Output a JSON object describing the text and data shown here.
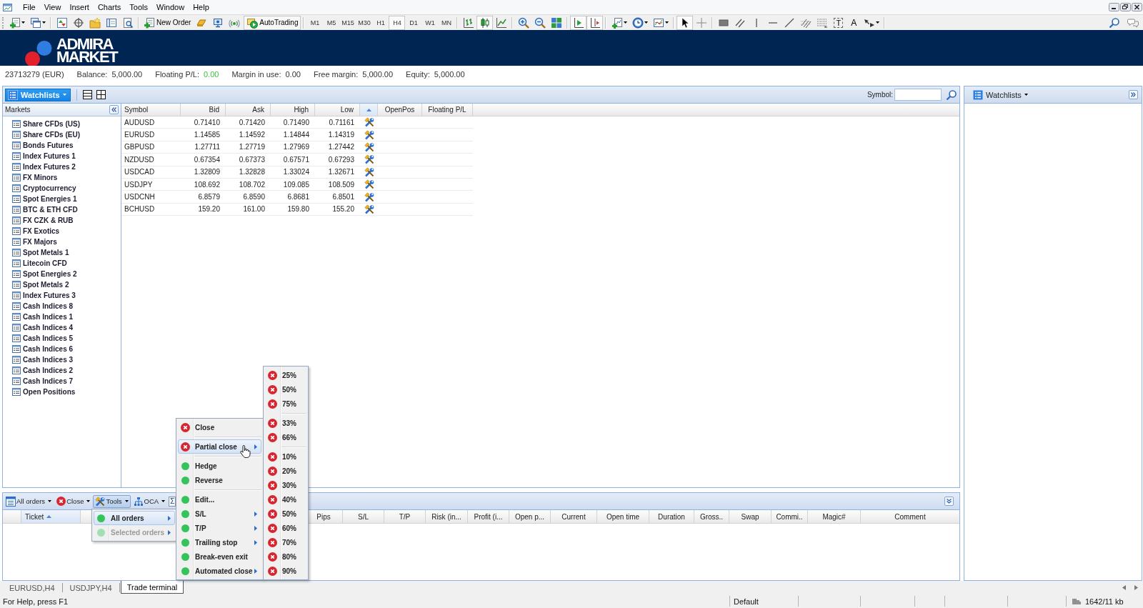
{
  "menu_bar": {
    "items": [
      "File",
      "View",
      "Insert",
      "Charts",
      "Tools",
      "Window",
      "Help"
    ]
  },
  "toolbar": {
    "new_order_label": "New Order",
    "autotrading": {
      "label": "AutoTrading",
      "on": true
    },
    "timeframes": [
      {
        "label": "M1",
        "selected": false
      },
      {
        "label": "M5",
        "selected": false
      },
      {
        "label": "M15",
        "selected": false
      },
      {
        "label": "M30",
        "selected": false
      },
      {
        "label": "H1",
        "selected": false
      },
      {
        "label": "H4",
        "selected": true
      },
      {
        "label": "D1",
        "selected": false
      },
      {
        "label": "W1",
        "selected": false
      },
      {
        "label": "MN",
        "selected": false
      }
    ],
    "chart_type_buttons": [
      {
        "selected": false
      },
      {
        "selected": true
      },
      {
        "selected": false
      }
    ],
    "chart_view_buttons": [
      {
        "selected": true
      },
      {
        "selected": true
      }
    ],
    "cursor_buttons": [
      {
        "selected": true
      },
      {
        "selected": false
      }
    ],
    "text_tool": "T",
    "label_tool": "A"
  },
  "logo": {
    "line1": "ADMIRA",
    "line2": "MARKET"
  },
  "account_bar": {
    "account": "23713279 (EUR)",
    "fields": [
      {
        "label": "Balance:",
        "value": "5,000.00",
        "kind": "amount"
      },
      {
        "label": "Floating P/L:",
        "value": "0.00",
        "kind": "pnl"
      },
      {
        "label": "Margin in use:",
        "value": "0.00",
        "kind": "amount"
      },
      {
        "label": "Free margin:",
        "value": "5,000.00",
        "kind": "amount"
      },
      {
        "label": "Equity:",
        "value": "5,000.00",
        "kind": "amount"
      }
    ]
  },
  "watchlist_panel": {
    "watchlists_button": "Watchlists",
    "symbol_search": {
      "label": "Symbol:"
    },
    "markets": {
      "title": "Markets",
      "items": [
        "Share CFDs (US)",
        "Share CFDs (EU)",
        "Bonds Futures",
        "Index Futures 1",
        "Index Futures 2",
        "FX Minors",
        "Cryptocurrency",
        "Spot Energies 1",
        "BTC & ETH CFD",
        "FX CZK & RUB",
        "FX Exotics",
        "FX Majors",
        "Spot Metals 1",
        "Litecoin CFD",
        "Spot Energies 2",
        "Spot Metals 2",
        "Index Futures 3",
        "Cash Indices 8",
        "Cash Indices 1",
        "Cash Indices 4",
        "Cash Indices 5",
        "Cash Indices 6",
        "Cash Indices 3",
        "Cash Indices 2",
        "Cash Indices 7",
        "Open Positions"
      ]
    },
    "table": {
      "columns": [
        {
          "kind": "symbol",
          "label": "Symbol",
          "sorted": false
        },
        {
          "kind": "price",
          "label": "Bid",
          "sorted": false
        },
        {
          "kind": "price",
          "label": "Ask",
          "sorted": false
        },
        {
          "kind": "price",
          "label": "High",
          "sorted": false
        },
        {
          "kind": "price",
          "label": "Low",
          "sorted": false
        },
        {
          "kind": "actions",
          "sorted": true
        },
        {
          "kind": "position",
          "label": "OpenPos",
          "sorted": false
        },
        {
          "kind": "position",
          "label": "Floating P/L",
          "sorted": false
        }
      ],
      "rows": [
        {
          "cells": [
            "AUDUSD",
            "0.71410",
            "0.71420",
            "0.71490",
            "0.71161"
          ]
        },
        {
          "cells": [
            "EURUSD",
            "1.14585",
            "1.14592",
            "1.14844",
            "1.14319"
          ]
        },
        {
          "cells": [
            "GBPUSD",
            "1.27711",
            "1.27719",
            "1.27969",
            "1.27442"
          ]
        },
        {
          "cells": [
            "NZDUSD",
            "0.67354",
            "0.67373",
            "0.67571",
            "0.67293"
          ]
        },
        {
          "cells": [
            "USDCAD",
            "1.32809",
            "1.32828",
            "1.33024",
            "1.32671"
          ]
        },
        {
          "cells": [
            "USDJPY",
            "108.692",
            "108.702",
            "109.085",
            "108.509"
          ]
        },
        {
          "cells": [
            "USDCNH",
            "6.8579",
            "6.8590",
            "6.8681",
            "6.8501"
          ]
        },
        {
          "cells": [
            "BCHUSD",
            "159.20",
            "161.00",
            "159.80",
            "155.20"
          ]
        }
      ]
    }
  },
  "right_panel": {
    "watchlists_button": "Watchlists"
  },
  "terminal": {
    "toolbar": [
      {
        "kind": "orders",
        "label": "All orders",
        "pressed": false
      },
      {
        "kind": "close",
        "label": "Close",
        "pressed": false
      },
      {
        "kind": "tools",
        "label": "Tools",
        "pressed": true
      },
      {
        "kind": "oca",
        "label": "OCA",
        "pressed": false
      },
      {
        "kind": "sum",
        "label": "Σ",
        "pressed": false
      }
    ],
    "columns": [
      {
        "label": "Ticket",
        "sorted": true
      },
      {
        "label": "Pips",
        "sorted": false
      },
      {
        "label": "S/L",
        "sorted": false
      },
      {
        "label": "T/P",
        "sorted": false
      },
      {
        "label": "Risk (in...",
        "sorted": false
      },
      {
        "label": "Profit (i...",
        "sorted": false
      },
      {
        "label": "Open p...",
        "sorted": false
      },
      {
        "label": "Current",
        "sorted": false
      },
      {
        "label": "Open time",
        "sorted": false
      },
      {
        "label": "Duration",
        "sorted": false
      },
      {
        "label": "Gross..",
        "sorted": false
      },
      {
        "label": "Swap",
        "sorted": false
      },
      {
        "label": "Commi..",
        "sorted": false
      },
      {
        "label": "Magic#",
        "sorted": false
      },
      {
        "label": "Comment",
        "sorted": false
      }
    ]
  },
  "tools_menu": {
    "items": [
      {
        "kind": "action",
        "label": "All orders",
        "selected": true,
        "disabled": false,
        "submenu": true
      },
      {
        "kind": "action",
        "label": "Selected orders",
        "selected": false,
        "disabled": true,
        "submenu": true
      }
    ]
  },
  "context_menu": {
    "items": [
      {
        "kind": "close",
        "label": "Close",
        "selected": false,
        "submenu": false
      },
      {
        "kind": "separator"
      },
      {
        "kind": "close",
        "label": "Partial close",
        "selected": true,
        "submenu": true
      },
      {
        "kind": "separator"
      },
      {
        "kind": "action",
        "label": "Hedge",
        "selected": false,
        "submenu": false
      },
      {
        "kind": "action",
        "label": "Reverse",
        "selected": false,
        "submenu": false
      },
      {
        "kind": "separator"
      },
      {
        "kind": "action",
        "label": "Edit...",
        "selected": false,
        "submenu": false
      },
      {
        "kind": "action",
        "label": "S/L",
        "selected": false,
        "submenu": true
      },
      {
        "kind": "action",
        "label": "T/P",
        "selected": false,
        "submenu": true
      },
      {
        "kind": "action",
        "label": "Trailing stop",
        "selected": false,
        "submenu": true
      },
      {
        "kind": "action",
        "label": "Break-even exit",
        "selected": false,
        "submenu": false
      },
      {
        "kind": "action",
        "label": "Automated close",
        "selected": false,
        "submenu": true
      }
    ]
  },
  "partial_close_menu": {
    "items": [
      {
        "kind": "close",
        "label": "25%",
        "selected": false
      },
      {
        "kind": "close",
        "label": "50%",
        "selected": false
      },
      {
        "kind": "close",
        "label": "75%",
        "selected": false
      },
      {
        "kind": "separator"
      },
      {
        "kind": "close",
        "label": "33%",
        "selected": false
      },
      {
        "kind": "close",
        "label": "66%",
        "selected": false
      },
      {
        "kind": "separator"
      },
      {
        "kind": "close",
        "label": "10%",
        "selected": false
      },
      {
        "kind": "close",
        "label": "20%",
        "selected": false
      },
      {
        "kind": "close",
        "label": "30%",
        "selected": false
      },
      {
        "kind": "close",
        "label": "40%",
        "selected": false
      },
      {
        "kind": "close",
        "label": "50%",
        "selected": false
      },
      {
        "kind": "close",
        "label": "60%",
        "selected": false
      },
      {
        "kind": "close",
        "label": "70%",
        "selected": false
      },
      {
        "kind": "close",
        "label": "80%",
        "selected": false
      },
      {
        "kind": "close",
        "label": "90%",
        "selected": false
      }
    ]
  },
  "chart_tabs": [
    {
      "label": "EURUSD,H4",
      "selected": false
    },
    {
      "label": "USDJPY,H4",
      "selected": false
    },
    {
      "label": "Trade terminal",
      "selected": true
    }
  ],
  "status_bar": {
    "help": "For Help, press F1",
    "profile": "Default",
    "traffic": "1642/11 kb"
  }
}
